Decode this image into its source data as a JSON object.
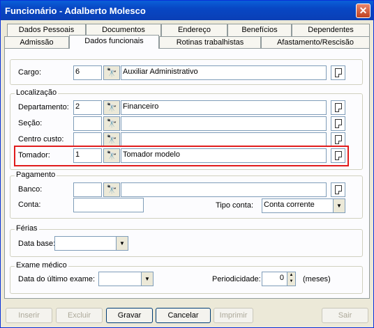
{
  "window": {
    "title": "Funcionário - Adalberto Molesco",
    "close_glyph": "✕"
  },
  "tabs_row1": [
    "Dados Pessoais",
    "Documentos",
    "Endereço",
    "Benefícios",
    "Dependentes"
  ],
  "tabs_row2": [
    "Admissão",
    "Dados funcionais",
    "Rotinas trabalhistas",
    "Afastamento/Rescisão"
  ],
  "active_tab": "Dados funcionais",
  "cargo": {
    "label": "Cargo:",
    "code": "6",
    "description": "Auxiliar Administrativo"
  },
  "localizacao": {
    "legend": "Localização",
    "departamento": {
      "label": "Departamento:",
      "code": "2",
      "description": "Financeiro"
    },
    "secao": {
      "label": "Seção:",
      "code": "",
      "description": ""
    },
    "centro_custo": {
      "label": "Centro custo:",
      "code": "",
      "description": ""
    },
    "tomador": {
      "label": "Tomador:",
      "code": "1",
      "description": "Tomador modelo"
    }
  },
  "pagamento": {
    "legend": "Pagamento",
    "banco_label": "Banco:",
    "banco_code": "",
    "banco_description": "",
    "conta_label": "Conta:",
    "conta_value": "",
    "tipo_conta_label": "Tipo conta:",
    "tipo_conta_value": "Conta corrente"
  },
  "ferias": {
    "legend": "Férias",
    "data_base_label": "Data base:",
    "data_base_value": ""
  },
  "exame": {
    "legend": "Exame médico",
    "ultimo_label": "Data do último exame:",
    "ultimo_value": "",
    "periodicidade_label": "Periodicidade:",
    "periodicidade_value": "0",
    "meses_label": "(meses)"
  },
  "buttons": {
    "inserir": "Inserir",
    "excluir": "Excluir",
    "gravar": "Gravar",
    "cancelar": "Cancelar",
    "imprimir": "Imprimir",
    "sair": "Sair"
  },
  "icons": {
    "binoculars": "binoculars-icon",
    "document": "document-icon",
    "dropdown": "dropdown-arrow-icon"
  },
  "colors": {
    "title_bar": "#0a4fc8",
    "highlight": "#e01b1b",
    "face": "#ece9d8"
  }
}
